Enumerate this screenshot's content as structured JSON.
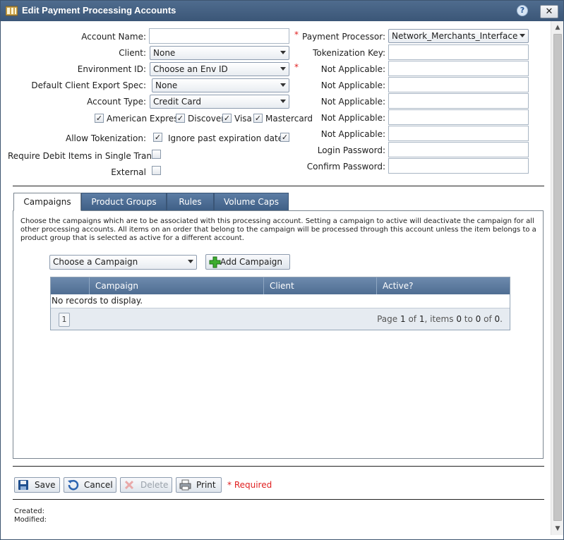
{
  "window": {
    "title": "Edit Payment Processing Accounts",
    "help_label": "?",
    "close_label": "✕"
  },
  "left_form": {
    "account_name_label": "Account Name:",
    "client_label": "Client:",
    "client_value": "None",
    "environment_label": "Environment ID:",
    "environment_value": "Choose an Env ID",
    "export_spec_label": "Default Client Export Spec:",
    "export_spec_value": "None",
    "account_type_label": "Account Type:",
    "account_type_value": "Credit Card",
    "cards": [
      "American Express",
      "Discover",
      "Visa",
      "Mastercard"
    ],
    "allow_tokenization_label": "Allow Tokenization:",
    "ignore_expiration_label": "Ignore past expiration dates:",
    "require_debit_label": "Require Debit Items in Single Tran:",
    "external_label": "External",
    "required_mark": "*"
  },
  "right_form": {
    "processor_label": "Payment Processor:",
    "processor_value": "Network_Merchants_Interface",
    "tokenization_key_label": "Tokenization Key:",
    "not_applicable_label": "Not Applicable:",
    "login_password_label": "Login Password:",
    "confirm_password_label": "Confirm Password:"
  },
  "tabs": [
    "Campaigns",
    "Product Groups",
    "Rules",
    "Volume Caps"
  ],
  "campaigns": {
    "description": "Choose the campaigns which are to be associated with this processing account. Setting a campaign to active will deactivate the campaign for all other processing accounts. All items on an order that belong to the campaign will be processed through this account unless the item belongs to a product group that is selected as active for a different account.",
    "select_value": "Choose a Campaign",
    "add_button": "Add Campaign",
    "columns": [
      "Campaign",
      "Client",
      "Active?"
    ],
    "empty_text": "No records to display.",
    "page_button": "1",
    "pager": {
      "page_word": "Page",
      "page": "1",
      "of_word": "of",
      "pages": "1",
      "items_word": ", items",
      "from": "0",
      "to_word": "to",
      "to": "0",
      "of_word2": "of",
      "total": "0",
      "end": "."
    }
  },
  "toolbar": {
    "save": "Save",
    "cancel": "Cancel",
    "delete": "Delete",
    "print": "Print",
    "required_note": "* Required"
  },
  "footer": {
    "created_label": "Created:",
    "modified_label": "Modified:"
  },
  "colors": {
    "titlebar": "#3b5677",
    "tab_inactive": "#4f6d92",
    "required": "#e02020"
  }
}
